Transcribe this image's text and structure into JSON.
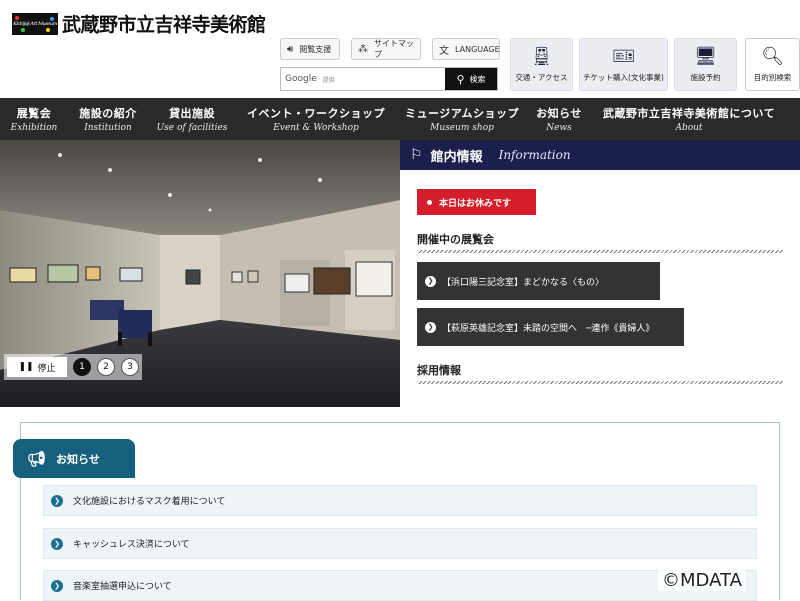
{
  "header": {
    "logo_text": "Kichijoji Art Museum",
    "title": "武蔵野市立吉祥寺美術館",
    "util": {
      "audio": "閲覧支援",
      "sitemap": "サイトマップ",
      "language": "LANGUAGE"
    },
    "search": {
      "brand": "Google",
      "brand_sub": "提供",
      "button": "検索"
    },
    "quick": {
      "access": "交通・アクセス",
      "ticket": "チケット購入(文化事業)",
      "facility": "施設予約",
      "find": "目的別検索"
    }
  },
  "nav": [
    {
      "jp": "展覧会",
      "en": "Exhibition"
    },
    {
      "jp": "施設の紹介",
      "en": "Institution"
    },
    {
      "jp": "貸出施設",
      "en": "Use of facilities"
    },
    {
      "jp": "イベント・ワークショップ",
      "en": "Event & Workshop"
    },
    {
      "jp": "ミュージアムショップ",
      "en": "Museum shop"
    },
    {
      "jp": "お知らせ",
      "en": "News"
    },
    {
      "jp": "武蔵野市立吉祥寺美術館について",
      "en": "About"
    }
  ],
  "slider": {
    "stop": "停止",
    "pages": [
      "1",
      "2",
      "3"
    ]
  },
  "info": {
    "title": "館内情報",
    "title_en": "Information",
    "closed": "本日はお休みです",
    "exhibitions_heading": "開催中の展覧会",
    "exhibitions": [
      "【浜口陽三記念室】まどかなる〈もの〉",
      "【萩原英雄記念室】未踏の空間へ　─連作《貴婦人》"
    ],
    "recruit_heading": "採用情報"
  },
  "news": {
    "title": "お知らせ",
    "items": [
      "文化施設におけるマスク着用について",
      "キャッシュレス決済について",
      "音楽室抽選申込について"
    ]
  },
  "watermark": "©MDATA",
  "colors": {
    "nav_bg": "#2a2a2a",
    "info_head": "#1b1f4b",
    "closed_badge": "#d31f2c",
    "news_tab": "#16607f"
  }
}
